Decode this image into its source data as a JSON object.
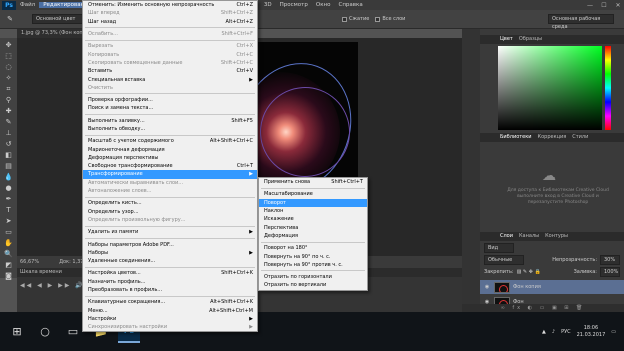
{
  "app": {
    "logo": "Ps"
  },
  "menubar": {
    "items": [
      "Файл",
      "Редактирование",
      "Изображение",
      "Слои",
      "Текст",
      "Выделение",
      "Фильтр",
      "3D",
      "Просмотр",
      "Окно",
      "Справка"
    ],
    "active_index": 1,
    "minimize": "—",
    "maximize": "☐",
    "close": "✕"
  },
  "options": {
    "style_combo": "Основной цвет",
    "checkbox1": "Сжатие",
    "checkbox2": "Все слои",
    "workspace_combo": "Основная рабочая среда"
  },
  "document": {
    "tab_title": "1.jpg @ 73,3% (Фон копия, RGB/8#) *"
  },
  "status": {
    "zoom": "66,67%",
    "doc_info": "Док: 1,37M/2,73M"
  },
  "timeline": {
    "title": "Шкала времени",
    "controls": "◀◀ ◀ ▶ ▶▶ 🔊"
  },
  "color_panel": {
    "tabs": [
      "Цвет",
      "Образцы"
    ]
  },
  "libraries_panel": {
    "tabs": [
      "Библиотеки",
      "Коррекция",
      "Стили"
    ],
    "text": "Для доступа к Библиотекам Creative Cloud выполните вход в Creative Cloud и перезапустите Photoshop"
  },
  "layers_panel": {
    "tabs": [
      "Слои",
      "Каналы",
      "Контуры"
    ],
    "kind_combo": "Вид",
    "blend_mode": "Обычные",
    "opacity_label": "Непрозрачность:",
    "opacity_value": "30%",
    "lock_label": "Закрепить:",
    "fill_label": "Заливка:",
    "fill_value": "100%",
    "layers": [
      {
        "name": "Фон копия",
        "selected": true
      },
      {
        "name": "Фон",
        "selected": false
      }
    ],
    "bottom_icons": "∞ fx ◐ ▭ ▣ ⊞ 🗑"
  },
  "edit_menu": {
    "items": [
      {
        "label": "Отменить: Изменить основную непрозрачность",
        "shortcut": "Ctrl+Z",
        "disabled": false
      },
      {
        "label": "Шаг вперед",
        "shortcut": "Shift+Ctrl+Z",
        "disabled": true
      },
      {
        "label": "Шаг назад",
        "shortcut": "Alt+Ctrl+Z",
        "disabled": false
      },
      {
        "sep": true
      },
      {
        "label": "Ослабить...",
        "shortcut": "Shift+Ctrl+F",
        "disabled": true
      },
      {
        "sep": true
      },
      {
        "label": "Вырезать",
        "shortcut": "Ctrl+X",
        "disabled": true
      },
      {
        "label": "Копировать",
        "shortcut": "Ctrl+C",
        "disabled": true
      },
      {
        "label": "Скопировать совмещенные данные",
        "shortcut": "Shift+Ctrl+C",
        "disabled": true
      },
      {
        "label": "Вставить",
        "shortcut": "Ctrl+V",
        "disabled": false
      },
      {
        "label": "Специальная вставка",
        "shortcut": "",
        "disabled": false,
        "submenu": true
      },
      {
        "label": "Очистить",
        "shortcut": "",
        "disabled": true
      },
      {
        "sep": true
      },
      {
        "label": "Проверка орфографии...",
        "shortcut": "",
        "disabled": false
      },
      {
        "label": "Поиск и замена текста...",
        "shortcut": "",
        "disabled": false
      },
      {
        "sep": true
      },
      {
        "label": "Выполнить заливку...",
        "shortcut": "Shift+F5",
        "disabled": false
      },
      {
        "label": "Выполнить обводку...",
        "shortcut": "",
        "disabled": false
      },
      {
        "sep": true
      },
      {
        "label": "Масштаб с учетом содержимого",
        "shortcut": "Alt+Shift+Ctrl+C",
        "disabled": false
      },
      {
        "label": "Марионеточная деформация",
        "shortcut": "",
        "disabled": false
      },
      {
        "label": "Деформация перспективы",
        "shortcut": "",
        "disabled": false
      },
      {
        "label": "Свободное трансформирование",
        "shortcut": "Ctrl+T",
        "disabled": false
      },
      {
        "label": "Трансформирование",
        "shortcut": "",
        "disabled": false,
        "submenu": true,
        "highlight": true
      },
      {
        "label": "Автоматически выравнивать слои...",
        "shortcut": "",
        "disabled": true
      },
      {
        "label": "Автоналожение слоев...",
        "shortcut": "",
        "disabled": true
      },
      {
        "sep": true
      },
      {
        "label": "Определить кисть...",
        "shortcut": "",
        "disabled": false
      },
      {
        "label": "Определить узор...",
        "shortcut": "",
        "disabled": false
      },
      {
        "label": "Определить произвольную фигуру...",
        "shortcut": "",
        "disabled": true
      },
      {
        "sep": true
      },
      {
        "label": "Удалить из памяти",
        "shortcut": "",
        "disabled": false,
        "submenu": true
      },
      {
        "sep": true
      },
      {
        "label": "Наборы параметров Adobe PDF...",
        "shortcut": "",
        "disabled": false
      },
      {
        "label": "Наборы",
        "shortcut": "",
        "disabled": false,
        "submenu": true
      },
      {
        "label": "Удаленные соединения...",
        "shortcut": "",
        "disabled": false
      },
      {
        "sep": true
      },
      {
        "label": "Настройка цветов...",
        "shortcut": "Shift+Ctrl+K",
        "disabled": false
      },
      {
        "label": "Назначить профиль...",
        "shortcut": "",
        "disabled": false
      },
      {
        "label": "Преобразовать в профиль...",
        "shortcut": "",
        "disabled": false
      },
      {
        "sep": true
      },
      {
        "label": "Клавиатурные сокращения...",
        "shortcut": "Alt+Shift+Ctrl+K",
        "disabled": false
      },
      {
        "label": "Меню...",
        "shortcut": "Alt+Shift+Ctrl+M",
        "disabled": false
      },
      {
        "label": "Настройки",
        "shortcut": "",
        "disabled": false,
        "submenu": true
      },
      {
        "label": "Синхронизировать настройки",
        "shortcut": "",
        "disabled": true,
        "submenu": true
      }
    ]
  },
  "transform_menu": {
    "items": [
      {
        "label": "Применить снова",
        "shortcut": "Shift+Ctrl+T"
      },
      {
        "sep": true
      },
      {
        "label": "Масштабирование",
        "shortcut": ""
      },
      {
        "label": "Поворот",
        "shortcut": "",
        "highlight": true
      },
      {
        "label": "Наклон",
        "shortcut": ""
      },
      {
        "label": "Искажение",
        "shortcut": ""
      },
      {
        "label": "Перспектива",
        "shortcut": ""
      },
      {
        "label": "Деформация",
        "shortcut": ""
      },
      {
        "sep": true
      },
      {
        "label": "Поворот на 180°",
        "shortcut": ""
      },
      {
        "label": "Повернуть на 90° по ч. с.",
        "shortcut": ""
      },
      {
        "label": "Повернуть на 90° против ч. с.",
        "shortcut": ""
      },
      {
        "sep": true
      },
      {
        "label": "Отразить по горизонтали",
        "shortcut": ""
      },
      {
        "label": "Отразить по вертикали",
        "shortcut": ""
      }
    ]
  },
  "taskbar": {
    "start": "⊞",
    "search": "○",
    "taskview": "▭",
    "explorer": "📁",
    "ps": "Ps",
    "tray_lang": "РУС",
    "time": "18:06",
    "date": "21.03.2017"
  }
}
